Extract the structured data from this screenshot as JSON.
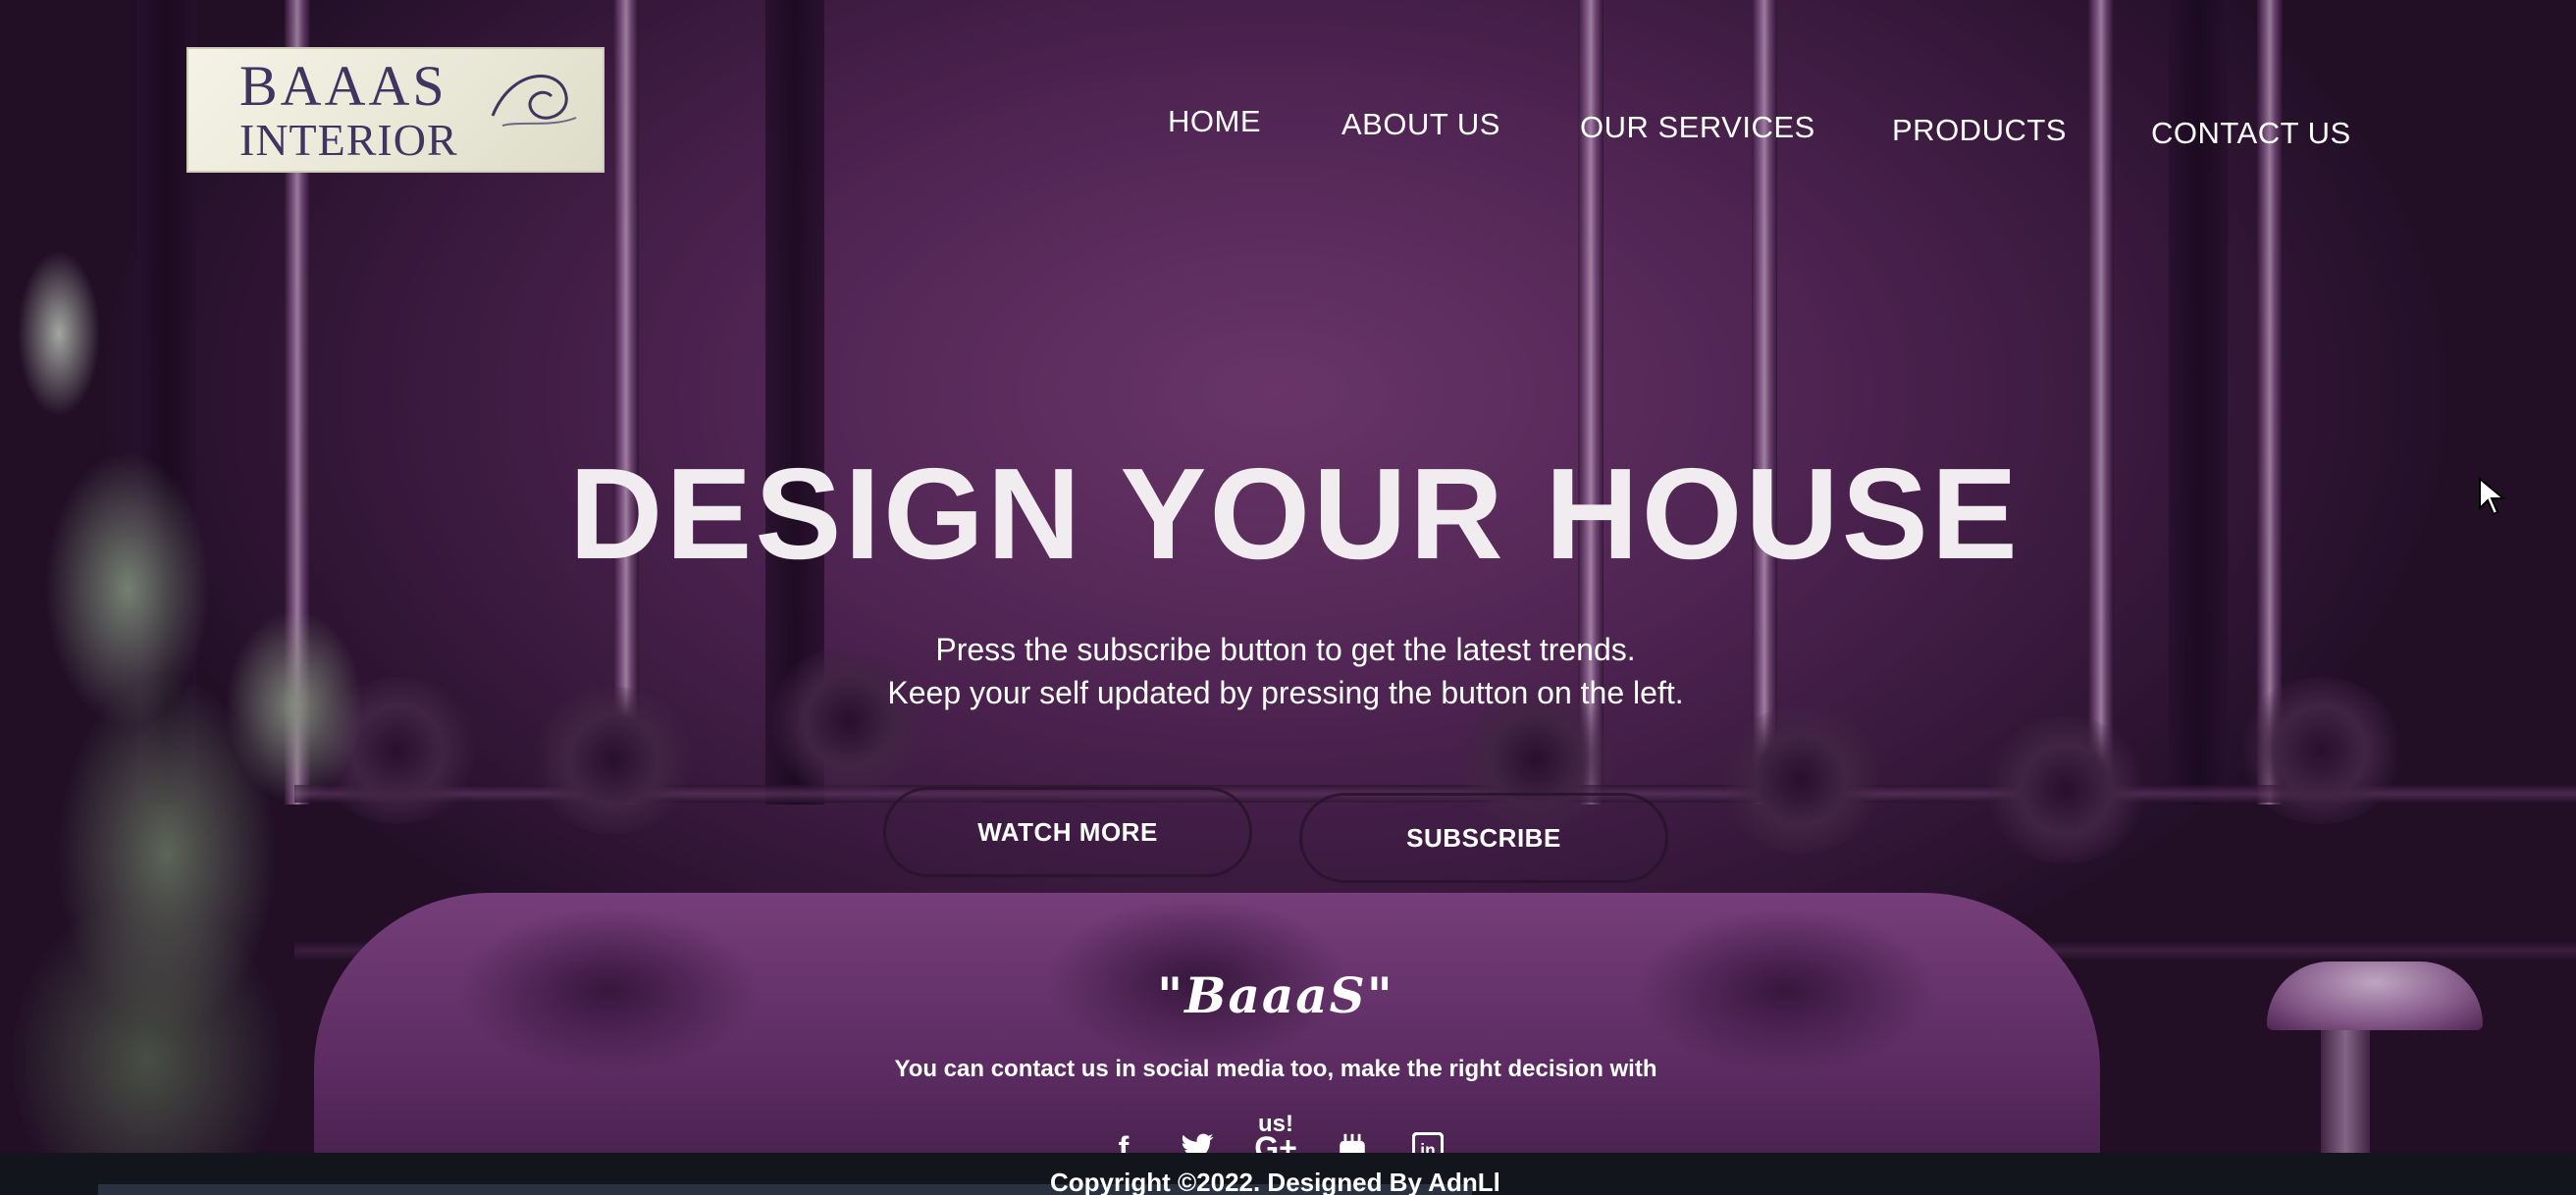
{
  "logo": {
    "line1": "BAAAS",
    "line2": "INTERIOR"
  },
  "nav": {
    "items": [
      {
        "label": "HOME"
      },
      {
        "label": "ABOUT US"
      },
      {
        "label": "OUR SERVICES"
      },
      {
        "label": "PRODUCTS"
      },
      {
        "label": "CONTACT US"
      }
    ]
  },
  "hero": {
    "title": "DESIGN YOUR HOUSE",
    "subtitle_line1": "Press the subscribe button to get the latest trends.",
    "subtitle_line2": "Keep your self updated by pressing the button on the left.",
    "watch_more_label": "WATCH MORE",
    "subscribe_label": "SUBSCRIBE"
  },
  "contact": {
    "brand_quote": "\"BaaaS\"",
    "text": "You can contact us in social media too, make the right decision with us!",
    "socials": [
      {
        "icon": "facebook-icon",
        "glyph": "f"
      },
      {
        "icon": "twitter-icon",
        "glyph": "🐦"
      },
      {
        "icon": "google-plus-icon",
        "glyph": "G+"
      },
      {
        "icon": "youtube-icon",
        "glyph": "▶"
      },
      {
        "icon": "linkedin-icon",
        "glyph": "in"
      }
    ]
  },
  "footer": {
    "copyright": "Copyright ©2022. Designed By AdnLl"
  },
  "colors": {
    "accent_purple": "#5a2a5d",
    "text_white": "#ffffff",
    "footer_bg": "#12151c"
  }
}
